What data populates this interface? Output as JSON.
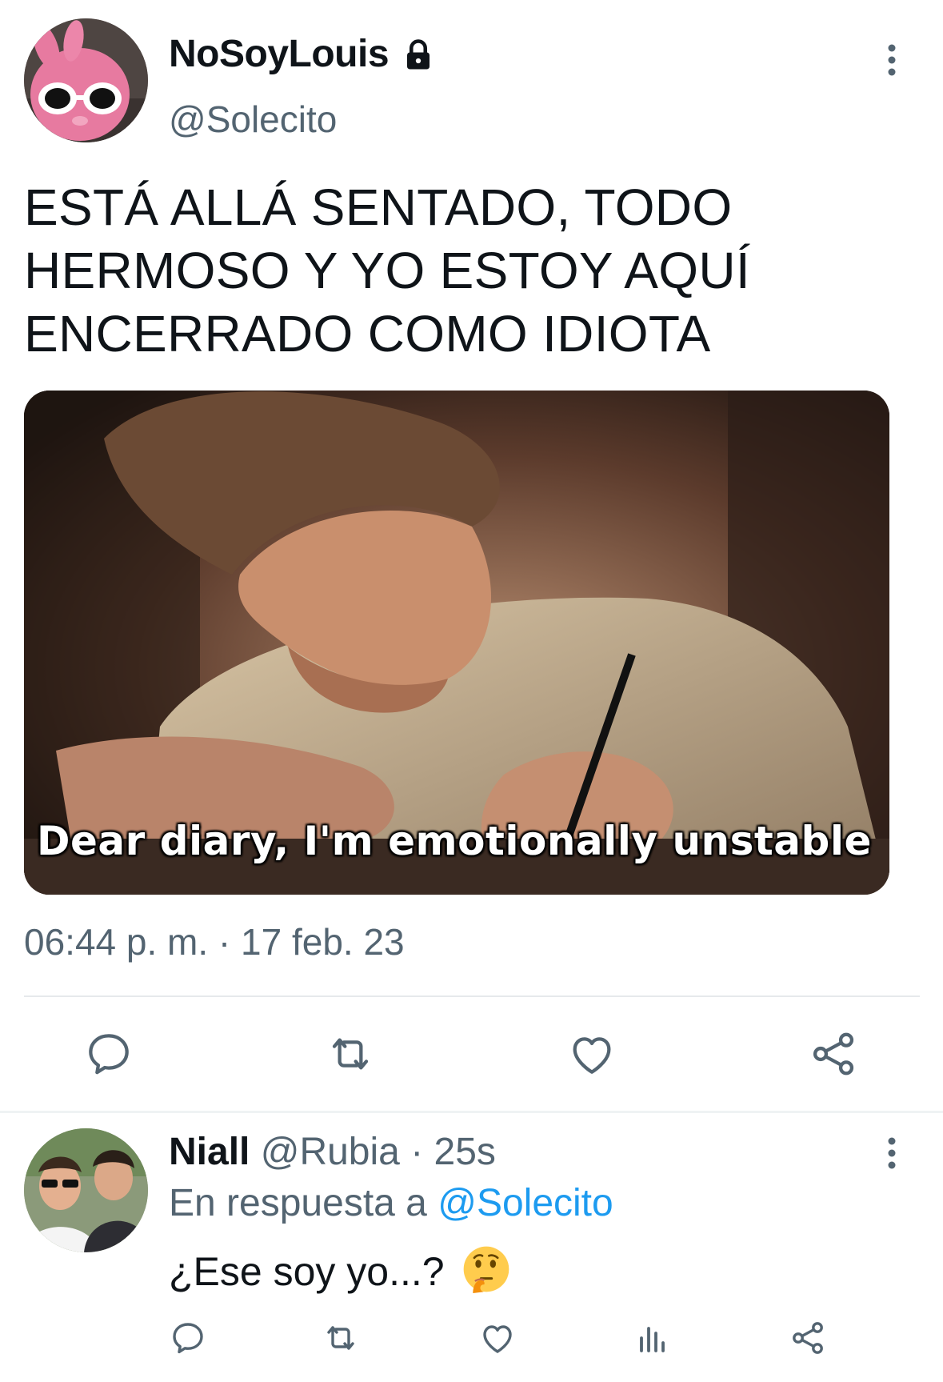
{
  "tweet": {
    "display_name": "NoSoyLouis",
    "handle": "@Solecito",
    "text_lines": [
      "ESTÁ ALLÁ SENTADO, TODO",
      "HERMOSO Y YO ESTOY AQUÍ",
      "ENCERRADO COMO IDIOTA"
    ],
    "media_caption": "Dear diary, I'm emotionally unstable",
    "timestamp": "06:44 p. m. · 17 feb. 23",
    "icons": {
      "lock": "lock-icon",
      "more": "more-vertical-icon",
      "reply": "reply-icon",
      "retweet": "retweet-icon",
      "like": "like-icon",
      "share": "share-icon"
    }
  },
  "reply": {
    "display_name": "Niall",
    "handle": "@Rubia",
    "time": "25s",
    "separator": "·",
    "reply_to_prefix": "En respuesta a",
    "reply_to_handle": "@Solecito",
    "text": "¿Ese soy yo...?",
    "emoji": "thinking-face-emoji",
    "icons": {
      "reply": "reply-icon",
      "retweet": "retweet-icon",
      "like": "like-icon",
      "views": "views-icon",
      "share": "share-icon",
      "more": "more-vertical-icon"
    }
  },
  "colors": {
    "text_primary": "#0f1419",
    "text_secondary": "#536471",
    "link": "#1d9bf0",
    "divider": "#e6e9ec",
    "icon": "#536471"
  }
}
